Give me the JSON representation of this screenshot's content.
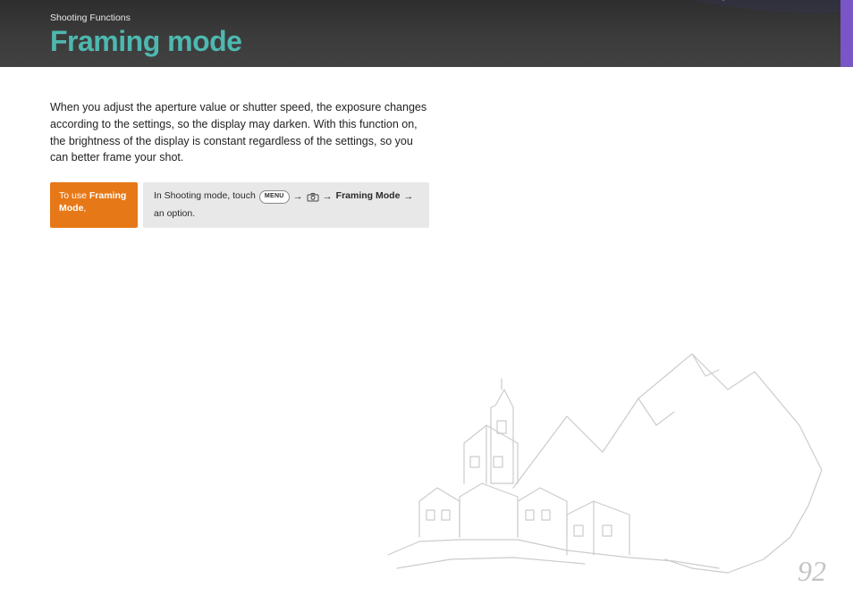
{
  "header": {
    "breadcrumb": "Shooting Functions",
    "title": "Framing mode"
  },
  "intro": "When you adjust the aperture value or shutter speed, the exposure changes according to the settings, so the display may darken. With this function on, the brightness of the display is constant regardless of the settings, so you can better frame your shot.",
  "instruction": {
    "label_prefix": "To use ",
    "label_bold": "Framing Mode",
    "label_suffix": ",",
    "step_prefix": "In Shooting mode, touch",
    "menu_button": "MENU",
    "arrow": "→",
    "step_bold": "Framing Mode",
    "step_suffix": "an option."
  },
  "page_number": "92",
  "colors": {
    "accent_teal": "#4eb8b0",
    "accent_orange": "#e77817",
    "accent_purple": "#7a55c7"
  }
}
